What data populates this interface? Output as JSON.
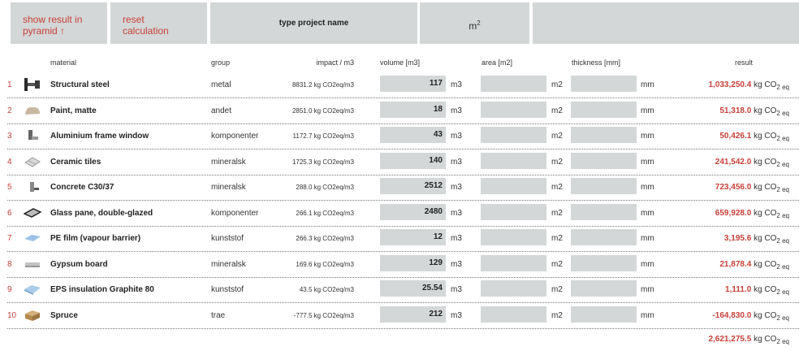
{
  "toolbar": {
    "show_pyramid": "show result in\npyramid ↑",
    "reset": "reset\ncalculation",
    "project_placeholder": "type project name",
    "unit_base": "m",
    "unit_exp": "2"
  },
  "headers": {
    "material": "material",
    "group": "group",
    "impact": "impact / m3",
    "volume": "volume [m3]",
    "area": "area [m2]",
    "thickness": "thickness [mm]",
    "result": "result"
  },
  "units": {
    "volume": "m3",
    "area": "m2",
    "thickness": "mm",
    "result_prefix": "kg CO",
    "result_sub": "2 eq"
  },
  "rows": [
    {
      "num": "1",
      "name": "Structural steel",
      "group": "metal",
      "impact": "8831.2 kg CO2eq/m3",
      "volume": "117",
      "result": "1,033,250.4",
      "icon": "steel-beam-icon"
    },
    {
      "num": "2",
      "name": "Paint, matte",
      "group": "andet",
      "impact": "2851.0 kg CO2eq/m3",
      "volume": "18",
      "result": "51,318.0",
      "icon": "paint-icon"
    },
    {
      "num": "3",
      "name": "Aluminium frame window",
      "group": "komponenter",
      "impact": "1172.7 kg CO2eq/m3",
      "volume": "43",
      "result": "50,426.1",
      "icon": "window-frame-icon"
    },
    {
      "num": "4",
      "name": "Ceramic tiles",
      "group": "mineralsk",
      "impact": "1725.3 kg CO2eq/m3",
      "volume": "140",
      "result": "241,542.0",
      "icon": "tiles-icon"
    },
    {
      "num": "5",
      "name": "Concrete C30/37",
      "group": "mineralsk",
      "impact": "288.0 kg CO2eq/m3",
      "volume": "2512",
      "result": "723,456.0",
      "icon": "concrete-icon"
    },
    {
      "num": "6",
      "name": "Glass pane, double-glazed",
      "group": "komponenter",
      "impact": "266.1 kg CO2eq/m3",
      "volume": "2480",
      "result": "659,928.0",
      "icon": "glass-pane-icon"
    },
    {
      "num": "7",
      "name": "PE film (vapour barrier)",
      "group": "kunststof",
      "impact": "266.3 kg CO2eq/m3",
      "volume": "12",
      "result": "3,195.6",
      "icon": "pe-film-icon"
    },
    {
      "num": "8",
      "name": "Gypsum board",
      "group": "mineralsk",
      "impact": "169.6 kg CO2eq/m3",
      "volume": "129",
      "result": "21,878.4",
      "icon": "gypsum-board-icon"
    },
    {
      "num": "9",
      "name": "EPS insulation Graphite 80",
      "group": "kunststof",
      "impact": "43.5 kg CO2eq/m3",
      "volume": "25.54",
      "result": "1,111.0",
      "icon": "eps-insulation-icon"
    },
    {
      "num": "10",
      "name": "Spruce",
      "group": "trae",
      "impact": "-777.5 kg CO2eq/m3",
      "volume": "212",
      "result": "-164,830.0",
      "icon": "spruce-wood-icon"
    }
  ],
  "total": "2,621,275.5",
  "colors": {
    "accent": "#c8413a",
    "field": "#d3d7d7"
  }
}
